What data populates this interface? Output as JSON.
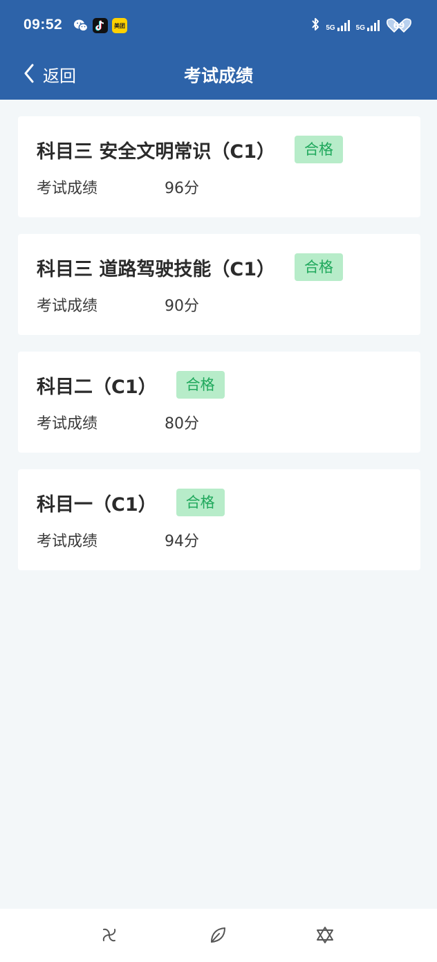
{
  "status_bar": {
    "time": "09:52",
    "app_icons": [
      "wechat-icon",
      "tiktok-icon",
      "meituan-icon"
    ],
    "meituan_label": "美团",
    "signal1_label": "5G",
    "signal2_label": "5G",
    "battery": "69"
  },
  "nav": {
    "back_label": "返回",
    "title": "考试成绩"
  },
  "results": [
    {
      "subject": "科目三 安全文明常识（C1）",
      "status": "合格",
      "score_label": "考试成绩",
      "score": "96分"
    },
    {
      "subject": "科目三 道路驾驶技能（C1）",
      "status": "合格",
      "score_label": "考试成绩",
      "score": "90分"
    },
    {
      "subject": "科目二（C1）",
      "status": "合格",
      "score_label": "考试成绩",
      "score": "80分"
    },
    {
      "subject": "科目一（C1）",
      "status": "合格",
      "score_label": "考试成绩",
      "score": "94分"
    }
  ],
  "bottom_bar": {
    "icons": [
      "pinwheel-icon",
      "leaf-icon",
      "star-of-david-icon"
    ]
  },
  "colors": {
    "header": "#2d63a9",
    "background": "#f3f7f9",
    "badge_bg": "#b7ecc9",
    "badge_text": "#1fa85c"
  }
}
